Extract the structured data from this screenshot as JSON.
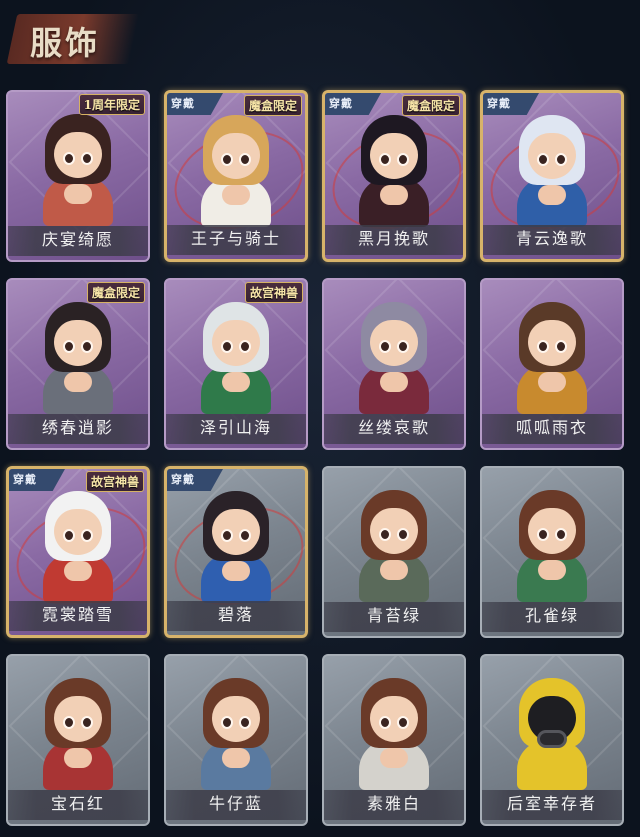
{
  "header": {
    "title": "服饰"
  },
  "cards": [
    {
      "name": "庆宴绮愿",
      "badge": "1周年限定",
      "equipped": false,
      "theme": "purple",
      "hair": "#3a2320",
      "outfit": "#c05a48"
    },
    {
      "name": "王子与骑士",
      "badge": "魔盒限定",
      "equipped": true,
      "theme": "purple",
      "hair": "#d7a65a",
      "outfit": "#f0ede6"
    },
    {
      "name": "黑月挽歌",
      "badge": "魔盒限定",
      "equipped": true,
      "theme": "purple",
      "hair": "#1e1822",
      "outfit": "#3a1f26"
    },
    {
      "name": "青云逸歌",
      "badge": "",
      "equipped": true,
      "theme": "purple",
      "hair": "#dfe6f2",
      "outfit": "#2f5fa8"
    },
    {
      "name": "绣春逍影",
      "badge": "魔盒限定",
      "equipped": false,
      "theme": "purple",
      "hair": "#2a2224",
      "outfit": "#6a6f7a"
    },
    {
      "name": "泽引山海",
      "badge": "故宫神兽",
      "equipped": false,
      "theme": "purple",
      "hair": "#dfe4e6",
      "outfit": "#2f7a4a"
    },
    {
      "name": "丝缕哀歌",
      "badge": "",
      "equipped": false,
      "theme": "purple",
      "hair": "#8e8aa2",
      "outfit": "#7a2a3c"
    },
    {
      "name": "呱呱雨衣",
      "badge": "",
      "equipped": false,
      "theme": "purple",
      "hair": "#5a3a28",
      "outfit": "#c88a2e"
    },
    {
      "name": "霓裳踏雪",
      "badge": "故宫神兽",
      "equipped": true,
      "theme": "purple",
      "hair": "#f2f2f2",
      "outfit": "#c03a32"
    },
    {
      "name": "碧落",
      "badge": "",
      "equipped": true,
      "theme": "gray",
      "hair": "#2a2228",
      "outfit": "#2f5fb0"
    },
    {
      "name": "青苔绿",
      "badge": "",
      "equipped": false,
      "theme": "gray",
      "hair": "#6a3a28",
      "outfit": "#5a6a5a"
    },
    {
      "name": "孔雀绿",
      "badge": "",
      "equipped": false,
      "theme": "gray",
      "hair": "#6a3a28",
      "outfit": "#3a7a50"
    },
    {
      "name": "宝石红",
      "badge": "",
      "equipped": false,
      "theme": "gray",
      "hair": "#6a3a28",
      "outfit": "#a83434"
    },
    {
      "name": "牛仔蓝",
      "badge": "",
      "equipped": false,
      "theme": "gray",
      "hair": "#6a3a28",
      "outfit": "#5a7aa0"
    },
    {
      "name": "素雅白",
      "badge": "",
      "equipped": false,
      "theme": "gray",
      "hair": "#6a3a28",
      "outfit": "#d4d2cc"
    },
    {
      "name": "后室幸存者",
      "badge": "",
      "equipped": false,
      "theme": "gray",
      "hair": "#e4c32a",
      "outfit": "#e4c32a",
      "icon": "gas-mask-icon"
    }
  ],
  "equipped_label": "穿戴"
}
